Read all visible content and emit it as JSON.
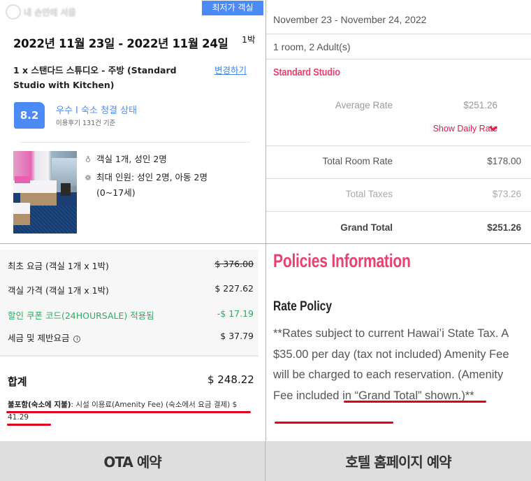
{
  "ota": {
    "watermark": "내 손안에 서울",
    "best_badge": "최저가 객실",
    "date_range": "2022년 11월 23일 - 2022년 11월 24일",
    "nights": "1박",
    "room_name": "1 x 스탠다드 스튜디오 - 주방 (Standard Studio with Kitchen)",
    "change_link": "변경하기",
    "score": "8.2",
    "score_title": "우수 I 숙소 청결 상태",
    "score_sub": "이용후기 131건 기준",
    "occupancy": "객실 1개, 성인 2명",
    "max_guests_line1": "최대 인원: 성인 2명, 아동 2명",
    "max_guests_line2": "(0~17세)",
    "prices": [
      {
        "label": "최초 요금 (객실 1개 x 1박)",
        "value": "$ 376.00",
        "strike": true
      },
      {
        "label": "객실 가격 (객실 1개 x 1박)",
        "value": "$ 227.62"
      },
      {
        "label": "할인 쿠폰 코드(24HOURSALE) 적용됨",
        "value": "-$ 17.19",
        "color": "#2bac62"
      },
      {
        "label": "세금 및 제반요금",
        "value": "$ 37.79",
        "icon": "info-icon"
      }
    ],
    "total_label": "합계",
    "total_value": "$ 248.22",
    "excluded_bold": "불포함(숙소에 지불)",
    "excluded_text": ": 시설 이용료(Amenity Fee) (숙소에서 요금 결제) $ 41.29"
  },
  "hotel": {
    "date_range": "November 23 - November 24, 2022",
    "room_guests": "1 room, 2 Adult(s)",
    "room_type": "Standard Studio",
    "average_rate_label": "Average Rate",
    "average_rate_value": "$251.26",
    "show_daily_rate": "Show Daily Rate",
    "total_room_rate_label": "Total Room Rate",
    "total_room_rate_value": "$178.00",
    "total_taxes_label": "Total Taxes",
    "total_taxes_value": "$73.26",
    "grand_total_label": "Grand Total",
    "grand_total_value": "$251.26",
    "policies_title": "Policies Information",
    "rate_policy_title": "Rate Policy",
    "policy_text_plain": "**Rates subject to current Hawai’i State Tax. A $35.00 per day (tax not included) Amenity Fee will be charged to each reservation. ",
    "policy_text_highlight": "(Amenity Fee included in “Grand Total” shown.)",
    "policy_text_end": "**"
  },
  "footer": {
    "left": "OTA 예약",
    "right": "호텔 홈페이지 예약"
  },
  "colors": {
    "ota_blue": "#4c8bf5",
    "hotel_pink": "#e8416f",
    "discount_green": "#2bac62",
    "highlight_red": "#e1001e"
  }
}
